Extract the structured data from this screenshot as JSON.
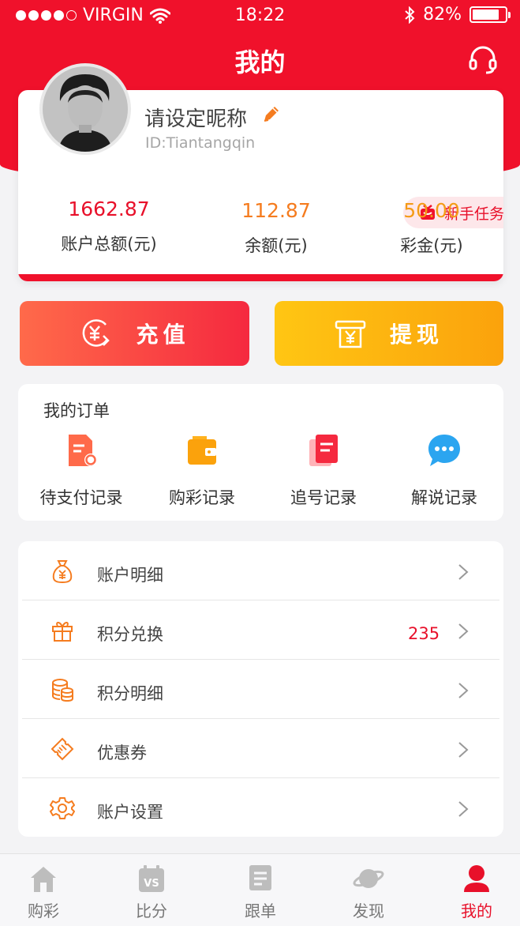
{
  "status_bar": {
    "carrier": "VIRGIN",
    "time": "18:22",
    "battery": "82%",
    "battery_level": 0.82
  },
  "header": {
    "title": "我的",
    "support_icon": "headset-icon"
  },
  "profile": {
    "nickname": "请设定昵称",
    "user_id": "ID:Tiantangqin",
    "task_badge": "新手任务",
    "stats": [
      {
        "value": "1662.87",
        "label": "账户总额(元)",
        "color": "#e8102a"
      },
      {
        "value": "112.87",
        "label": "余额(元)",
        "color": "#f57c1f"
      },
      {
        "value": "50.00",
        "label": "彩金(元)",
        "color": "#f49b16"
      }
    ]
  },
  "actions": {
    "recharge": "充值",
    "withdraw": "提现"
  },
  "orders": {
    "title": "我的订单",
    "items": [
      {
        "label": "待支付记录",
        "icon": "pending-payment-icon"
      },
      {
        "label": "购彩记录",
        "icon": "wallet-icon"
      },
      {
        "label": "追号记录",
        "icon": "chase-number-icon"
      },
      {
        "label": "解说记录",
        "icon": "chat-bubble-icon"
      }
    ]
  },
  "menu": [
    {
      "label": "账户明细",
      "icon": "money-bag-icon",
      "count": ""
    },
    {
      "label": "积分兑换",
      "icon": "gift-icon",
      "count": "235"
    },
    {
      "label": "积分明细",
      "icon": "coins-icon",
      "count": ""
    },
    {
      "label": "优惠券",
      "icon": "coupon-icon",
      "count": ""
    },
    {
      "label": "账户设置",
      "icon": "settings-gear-icon",
      "count": ""
    }
  ],
  "tabs": [
    {
      "label": "购彩",
      "icon": "home-icon",
      "active": false
    },
    {
      "label": "比分",
      "icon": "vs-calendar-icon",
      "active": false
    },
    {
      "label": "跟单",
      "icon": "document-icon",
      "active": false
    },
    {
      "label": "发现",
      "icon": "planet-icon",
      "active": false
    },
    {
      "label": "我的",
      "icon": "user-icon",
      "active": true
    }
  ],
  "colors": {
    "brand_red": "#f0112b",
    "accent_orange": "#f57c1f",
    "accent_yellow": "#fba20c"
  }
}
